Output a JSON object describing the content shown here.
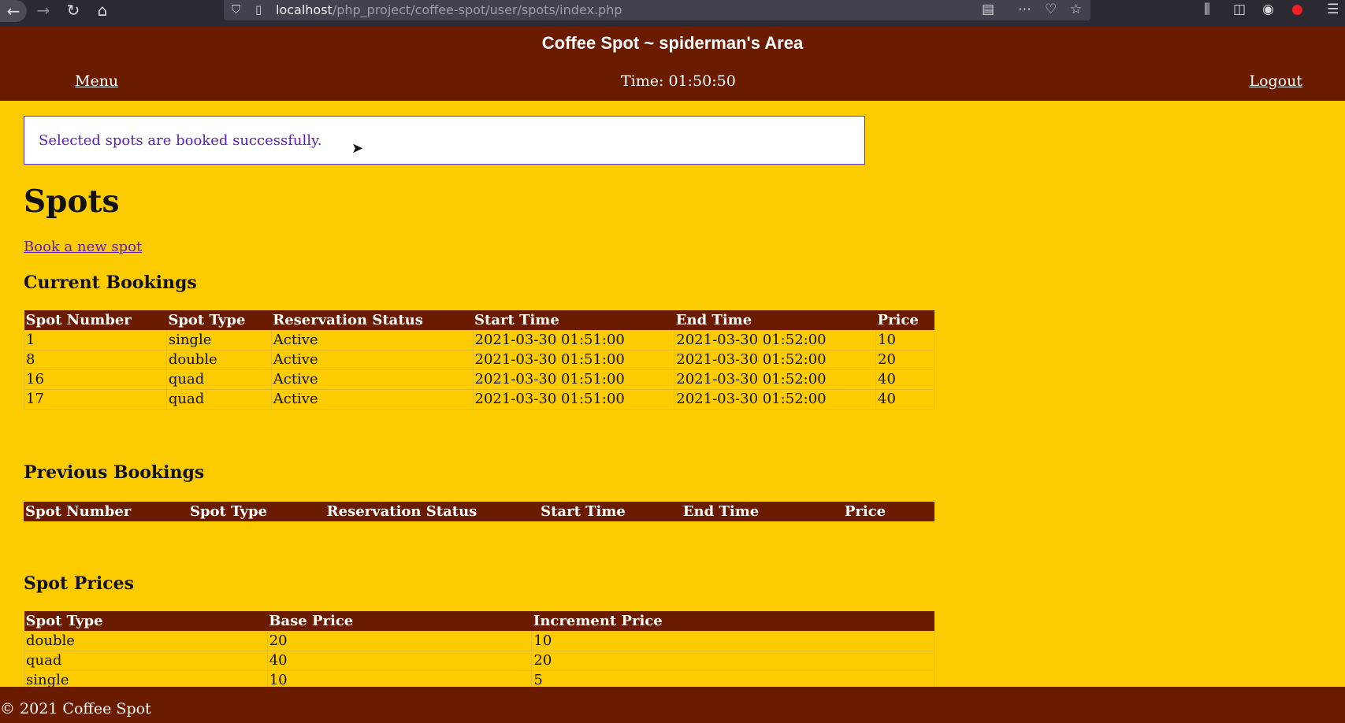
{
  "browser": {
    "url_host": "localhost",
    "url_path": "/php_project/coffee-spot/user/spots/index.php"
  },
  "header": {
    "title": "Coffee Spot ~ spiderman's Area",
    "menu_label": "Menu",
    "time_text": "Time: 01:50:50",
    "logout_label": "Logout"
  },
  "alert": {
    "message": "Selected spots are booked successfully."
  },
  "page": {
    "title": "Spots",
    "book_link": "Book a new spot"
  },
  "current_bookings": {
    "title": "Current Bookings",
    "columns": [
      "Spot Number",
      "Spot Type",
      "Reservation Status",
      "Start Time",
      "End Time",
      "Price"
    ],
    "rows": [
      [
        "1",
        "single",
        "Active",
        "2021-03-30 01:51:00",
        "2021-03-30 01:52:00",
        "10"
      ],
      [
        "8",
        "double",
        "Active",
        "2021-03-30 01:51:00",
        "2021-03-30 01:52:00",
        "20"
      ],
      [
        "16",
        "quad",
        "Active",
        "2021-03-30 01:51:00",
        "2021-03-30 01:52:00",
        "40"
      ],
      [
        "17",
        "quad",
        "Active",
        "2021-03-30 01:51:00",
        "2021-03-30 01:52:00",
        "40"
      ]
    ]
  },
  "previous_bookings": {
    "title": "Previous Bookings",
    "columns": [
      "Spot Number",
      "Spot Type",
      "Reservation Status",
      "Start Time",
      "End Time",
      "Price"
    ]
  },
  "spot_prices": {
    "title": "Spot Prices",
    "columns": [
      "Spot Type",
      "Base Price",
      "Increment Price"
    ],
    "rows": [
      [
        "double",
        "20",
        "10"
      ],
      [
        "quad",
        "40",
        "20"
      ],
      [
        "single",
        "10",
        "5"
      ]
    ]
  },
  "footer": {
    "text": "© 2021 Coffee Spot"
  },
  "colors": {
    "header_bg": "#6b1b00",
    "page_bg": "#fccc00",
    "alert_text": "#5b1fb5"
  }
}
